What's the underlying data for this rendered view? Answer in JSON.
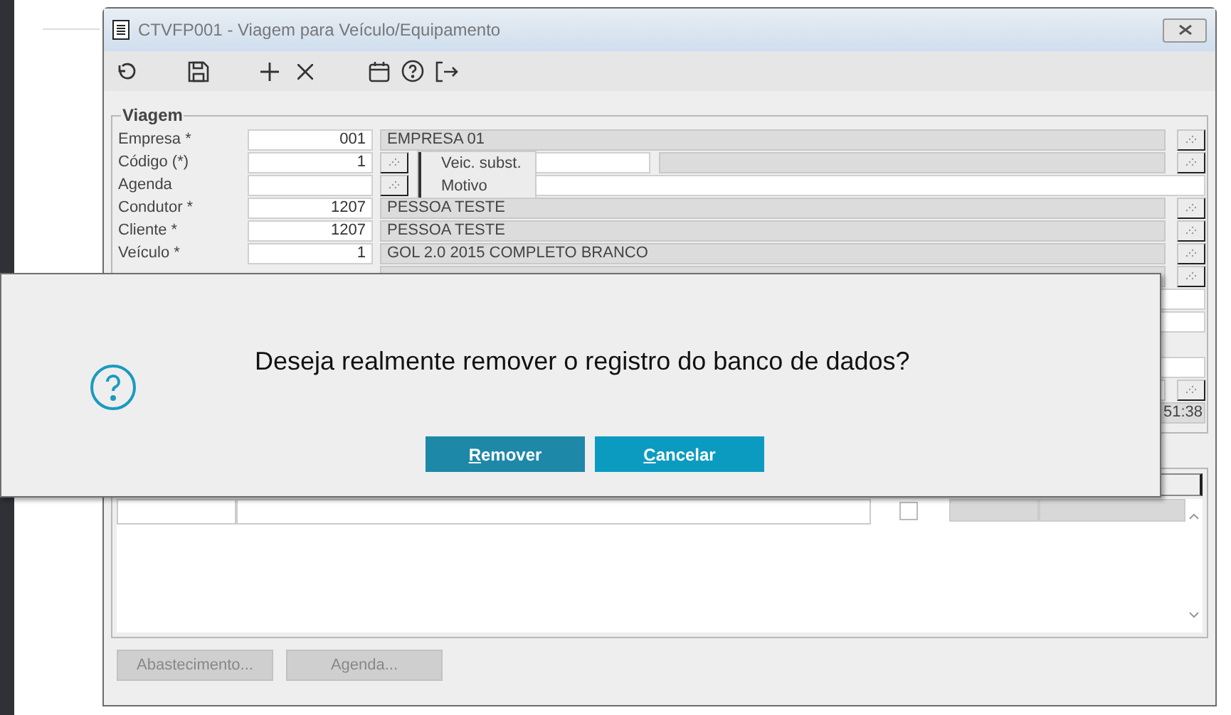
{
  "window": {
    "title": "CTVFP001 - Viagem para Veículo/Equipamento"
  },
  "group": {
    "title": "Viagem",
    "fields": [
      {
        "kind": "lookup",
        "label": "Empresa *",
        "code": "001",
        "description": "EMPRESA 01"
      },
      {
        "kind": "code",
        "label": "Código (*)",
        "code": "1"
      },
      {
        "kind": "agenda",
        "label": "Agenda"
      },
      {
        "kind": "lookup",
        "label": "Condutor *",
        "code": "1207",
        "description": "PESSOA TESTE"
      },
      {
        "kind": "lookup",
        "label": "Cliente *",
        "code": "1207",
        "description": "PESSOA TESTE"
      },
      {
        "kind": "lookup",
        "label": "Veículo *",
        "code": "1",
        "description": "GOL 2.0 2015 COMPLETO BRANCO"
      }
    ],
    "popup_menu": [
      "Veic. subst.",
      "Motivo"
    ],
    "time_fragment": "51:38"
  },
  "grid": {
    "checkbox": {
      "checked": false
    }
  },
  "buttons": [
    {
      "label": "Abastecimento...",
      "disabled": true
    },
    {
      "label": "Agenda...",
      "disabled": true
    }
  ],
  "dialog": {
    "message": "Deseja realmente remover o registro do banco de dados?",
    "buttons": [
      {
        "label": "Remover",
        "focused": true
      },
      {
        "label": "Cancelar",
        "focused": false
      }
    ]
  }
}
